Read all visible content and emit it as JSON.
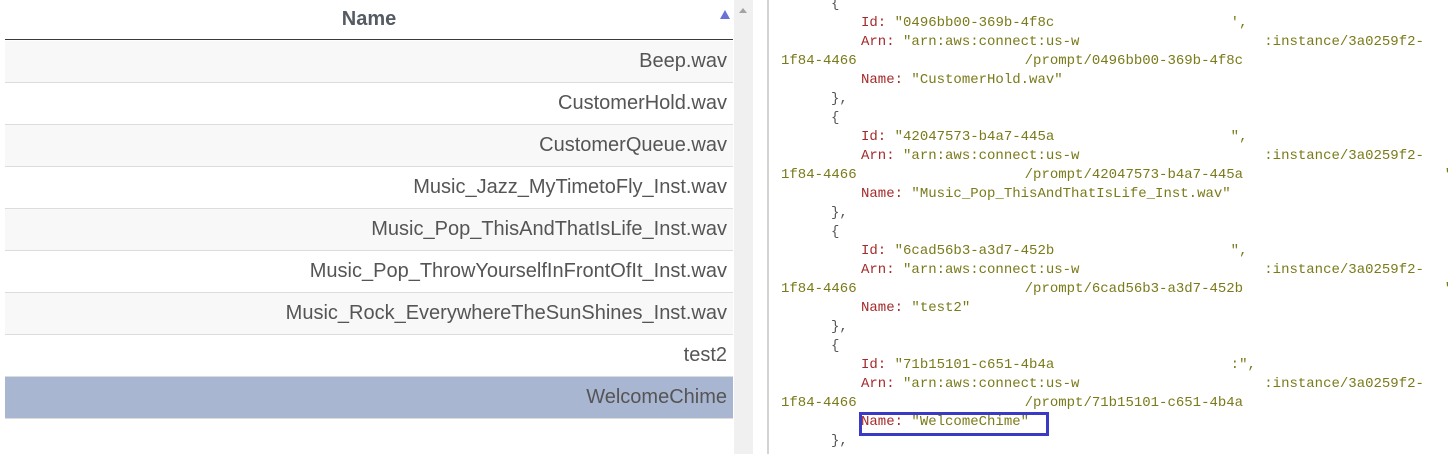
{
  "table": {
    "header": "Name",
    "rows": [
      {
        "name": "Beep.wav"
      },
      {
        "name": "CustomerHold.wav"
      },
      {
        "name": "CustomerQueue.wav"
      },
      {
        "name": "Music_Jazz_MyTimetoFly_Inst.wav"
      },
      {
        "name": "Music_Pop_ThisAndThatIsLife_Inst.wav"
      },
      {
        "name": "Music_Pop_ThrowYourselfInFrontOfIt_Inst.wav"
      },
      {
        "name": "Music_Rock_EverywhereTheSunShines_Inst.wav"
      },
      {
        "name": "test2"
      },
      {
        "name": "WelcomeChime"
      }
    ],
    "selected": "WelcomeChime"
  },
  "code": {
    "open_brace": "{",
    "close_brace": "},",
    "entries": [
      {
        "id_key": "Id:",
        "id_val": "\"0496bb00-369b-4f8c                     ',",
        "arn_key": "Arn:",
        "arn_val": "\"arn:aws:connect:us-w                      :instance/3a0259f2-",
        "arn_cont": "1f84-4466                    /prompt/0496bb00-369b-4f8c                        .\",",
        "name_key": "Name:",
        "name_val": "\"CustomerHold.wav\""
      },
      {
        "id_key": "Id:",
        "id_val": "\"42047573-b4a7-445a                     \",",
        "arn_key": "Arn:",
        "arn_val": "\"arn:aws:connect:us-w                      :instance/3a0259f2-",
        "arn_cont": "1f84-4466                    /prompt/42047573-b4a7-445a                        \",",
        "name_key": "Name:",
        "name_val": "\"Music_Pop_ThisAndThatIsLife_Inst.wav\""
      },
      {
        "id_key": "Id:",
        "id_val": "\"6cad56b3-a3d7-452b                     \",",
        "arn_key": "Arn:",
        "arn_val": "\"arn:aws:connect:us-w                      :instance/3a0259f2-",
        "arn_cont": "1f84-4466                    /prompt/6cad56b3-a3d7-452b                        \",",
        "name_key": "Name:",
        "name_val": "\"test2\""
      },
      {
        "id_key": "Id:",
        "id_val": "\"71b15101-c651-4b4a                     :\",",
        "arn_key": "Arn:",
        "arn_val": "\"arn:aws:connect:us-w                      :instance/3a0259f2-",
        "arn_cont": "1f84-4466                    /prompt/71b15101-c651-4b4a                        :\",",
        "name_key": "Name:",
        "name_val": "\"WelcomeChime\""
      }
    ]
  }
}
